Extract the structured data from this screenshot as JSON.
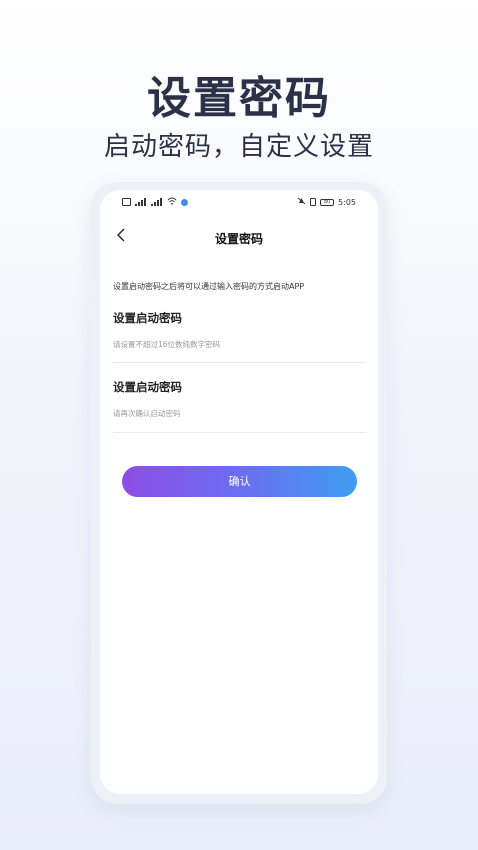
{
  "hero": {
    "title": "设置密码",
    "subtitle": "启动密码，自定义设置"
  },
  "status_bar": {
    "time": "5:05",
    "left_icons": [
      "sim-card-icon",
      "signal-icon",
      "signal-icon",
      "wifi-icon",
      "app-notification-icon"
    ],
    "right_icons": [
      "mute-icon",
      "vibrate-icon",
      "battery-icon"
    ],
    "battery_level": "80"
  },
  "nav": {
    "title": "设置密码",
    "back_icon": "chevron-left-icon"
  },
  "form": {
    "hint": "设置启动密码之后将可以通过输入密码的方式启动APP",
    "field1_label": "设置启动密码",
    "field1_placeholder": "请设置不超过16位数纯数字密码",
    "field2_label": "设置启动密码",
    "field2_placeholder": "请再次确认启动密码",
    "confirm_label": "确认"
  },
  "colors": {
    "button_gradient_start": "#8e4ee6",
    "button_gradient_end": "#3f9df2",
    "title_color": "#2d3147"
  }
}
